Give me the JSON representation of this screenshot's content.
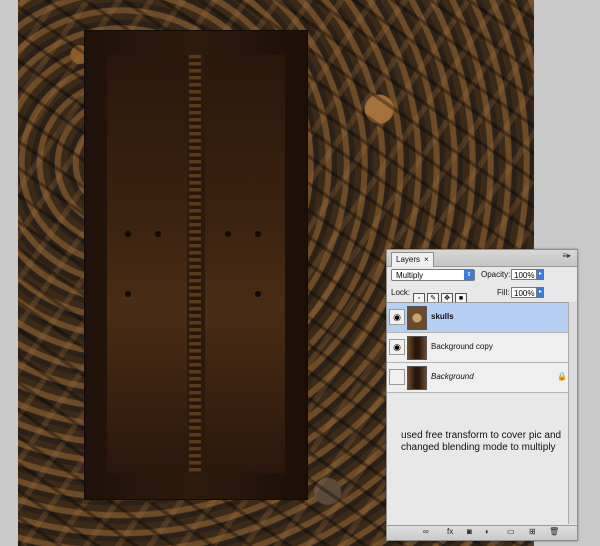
{
  "layers_panel": {
    "tab_label": "Layers",
    "tab_close": "×",
    "menu_icon": "panel-menu-icon",
    "blend_mode": "Multiply",
    "opacity_label": "Opacity:",
    "opacity_value": "100%",
    "lock_label": "Lock:",
    "fill_label": "Fill:",
    "fill_value": "100%",
    "layers": [
      {
        "name": "skulls",
        "visible": true,
        "selected": true
      },
      {
        "name": "Background copy",
        "visible": true,
        "selected": false
      },
      {
        "name": "Background",
        "visible": false,
        "selected": false,
        "locked": true
      }
    ],
    "footer_icons": [
      "link-icon",
      "fx-icon",
      "mask-icon",
      "adjustment-icon",
      "group-icon",
      "new-layer-icon",
      "trash-icon"
    ]
  },
  "annotation": "used free transform to cover pic and changed blending mode to multiply"
}
